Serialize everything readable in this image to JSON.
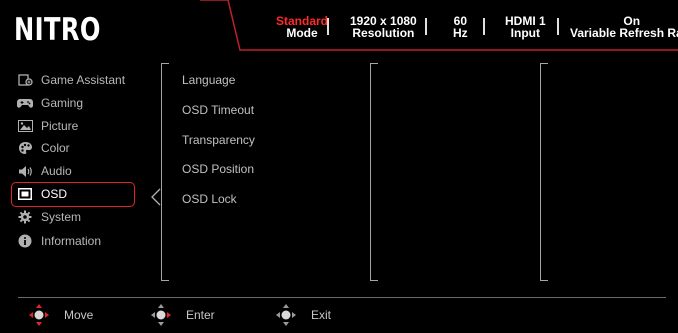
{
  "logo": "NITRO",
  "status": [
    {
      "value": "Standard",
      "label": "Mode"
    },
    {
      "value": "1920 x 1080",
      "label": "Resolution"
    },
    {
      "value": "60",
      "label": "Hz"
    },
    {
      "value": "HDMI 1",
      "label": "Input"
    },
    {
      "value": "On",
      "label": "Variable Refresh Rate"
    }
  ],
  "menu": [
    {
      "label": "Game Assistant",
      "icon": "game-assistant-icon"
    },
    {
      "label": "Gaming",
      "icon": "gamepad-icon"
    },
    {
      "label": "Picture",
      "icon": "picture-icon"
    },
    {
      "label": "Color",
      "icon": "palette-icon"
    },
    {
      "label": "Audio",
      "icon": "speaker-icon"
    },
    {
      "label": "OSD",
      "icon": "osd-icon",
      "active": true
    },
    {
      "label": "System",
      "icon": "gear-icon"
    },
    {
      "label": "Information",
      "icon": "info-icon"
    }
  ],
  "submenu": [
    "Language",
    "OSD Timeout",
    "Transparency",
    "OSD Position",
    "OSD Lock"
  ],
  "nav": [
    {
      "label": "Move"
    },
    {
      "label": "Enter"
    },
    {
      "label": "Exit"
    }
  ],
  "colors": {
    "accent": "#e0262b",
    "background": "#000000",
    "text": "#c8c8c8"
  }
}
